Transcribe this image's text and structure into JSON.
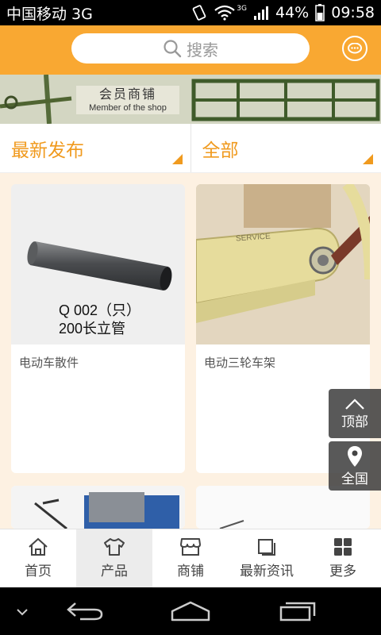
{
  "status_bar": {
    "carrier": "中国移动 3G",
    "network_badge": "3G",
    "battery_percent": "44%",
    "time": "09:58"
  },
  "header": {
    "search_placeholder": "搜索",
    "search_icon": "search-icon",
    "message_icon": "chat-bubble-icon"
  },
  "banner": {
    "title": "会员商铺",
    "subtitle": "Member of the shop"
  },
  "filters": {
    "sort_label": "最新发布",
    "category_label": "全部"
  },
  "products": [
    {
      "name": "电动车散件",
      "image_text_line1": "Q 002（只）",
      "image_text_line2": "200长立管"
    },
    {
      "name": "电动三轮车架",
      "image_text_line1": "SERVICE"
    }
  ],
  "float_buttons": {
    "top_label": "顶部",
    "nationwide_label": "全国"
  },
  "tabs": [
    {
      "label": "首页",
      "icon": "home-icon"
    },
    {
      "label": "产品",
      "icon": "shirt-icon",
      "active": true
    },
    {
      "label": "商铺",
      "icon": "shop-icon"
    },
    {
      "label": "最新资讯",
      "icon": "news-icon"
    },
    {
      "label": "更多",
      "icon": "grid-icon"
    }
  ],
  "colors": {
    "brand_orange": "#f9a832",
    "accent_orange": "#f09a1e",
    "page_bg": "#fdf1e2"
  }
}
